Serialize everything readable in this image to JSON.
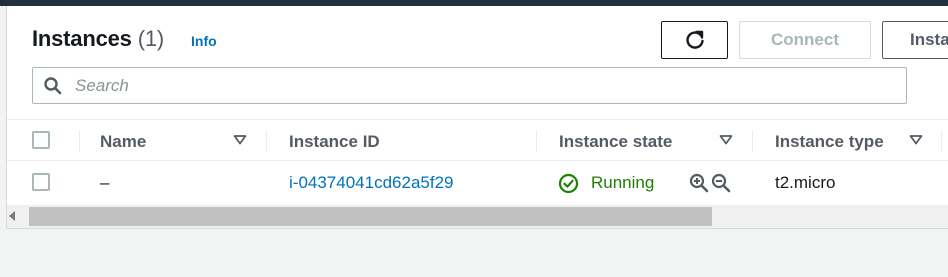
{
  "header": {
    "title": "Instances",
    "count": "(1)",
    "info_label": "Info"
  },
  "toolbar": {
    "refresh_label": "",
    "connect_label": "Connect",
    "launch_label": "Insta"
  },
  "search": {
    "placeholder": "Search"
  },
  "table": {
    "columns": [
      {
        "label": "Name"
      },
      {
        "label": "Instance ID"
      },
      {
        "label": "Instance state"
      },
      {
        "label": "Instance type"
      }
    ],
    "rows": [
      {
        "name": "–",
        "instance_id": "i-04374041cd62a5f29",
        "state": "Running",
        "type": "t2.micro"
      }
    ]
  },
  "colors": {
    "link": "#0073bb",
    "running": "#1d8102",
    "topbar": "#232f3e"
  },
  "icons": {
    "refresh": "refresh-icon",
    "search": "search-icon",
    "sort": "sort-caret-icon",
    "running": "check-circle-icon",
    "zoom_in": "zoom-in-icon",
    "zoom_out": "zoom-out-icon"
  }
}
